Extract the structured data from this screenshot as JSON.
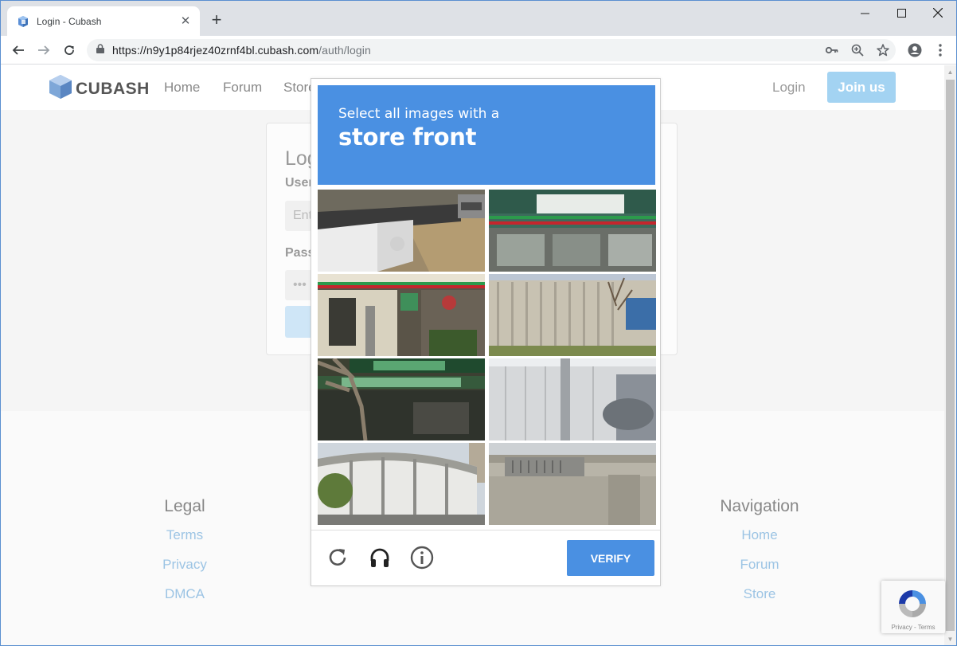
{
  "browser": {
    "tab_title": "Login - Cubash",
    "url_host": "https://n9y1p84rjez40zrnf4bl.cubash.com",
    "url_path": "/auth/login"
  },
  "header": {
    "logo_text": "CUBASH",
    "nav": [
      "Home",
      "Forum",
      "Store"
    ],
    "login": "Login",
    "join": "Join us"
  },
  "login_form": {
    "title": "Log",
    "username_label": "User",
    "username_placeholder": "Ent",
    "password_label": "Pass",
    "password_value": "•••"
  },
  "footer": {
    "legal": {
      "heading": "Legal",
      "links": [
        "Terms",
        "Privacy",
        "DMCA"
      ]
    },
    "navigation": {
      "heading": "Navigation",
      "links": [
        "Home",
        "Forum",
        "Store"
      ]
    }
  },
  "captcha": {
    "prompt": "Select all images with a",
    "target": "store front",
    "verify_label": "VERIFY",
    "accent": "#4a90e2"
  },
  "recaptcha_badge": {
    "text": "Privacy - Terms"
  }
}
